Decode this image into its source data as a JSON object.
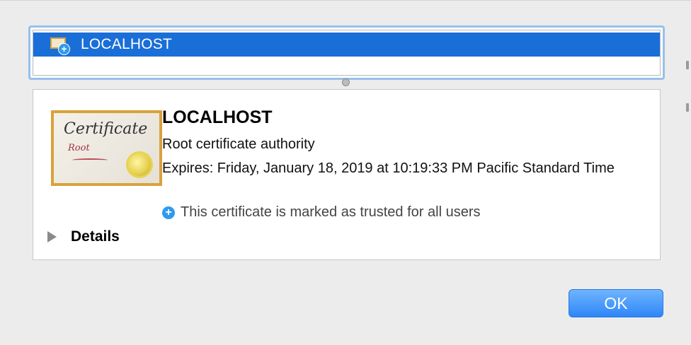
{
  "certificate_list": {
    "rows": [
      {
        "label": "LOCALHOST",
        "icon": "certificate-trusted-icon",
        "selected": true
      }
    ]
  },
  "certificate_detail": {
    "image_text_title": "Certificate",
    "image_text_subtitle": "Root",
    "name": "LOCALHOST",
    "type": "Root certificate authority",
    "expires": "Expires: Friday, January 18, 2019 at 10:19:33 PM Pacific Standard Time",
    "trust_icon": "+",
    "trust_status": "This certificate is marked as trusted for all users",
    "details_label": "Details"
  },
  "buttons": {
    "ok_label": "OK"
  },
  "colors": {
    "selection": "#1a6ed8",
    "accent": "#2d9af0",
    "ok_button": "#2d86f7"
  }
}
